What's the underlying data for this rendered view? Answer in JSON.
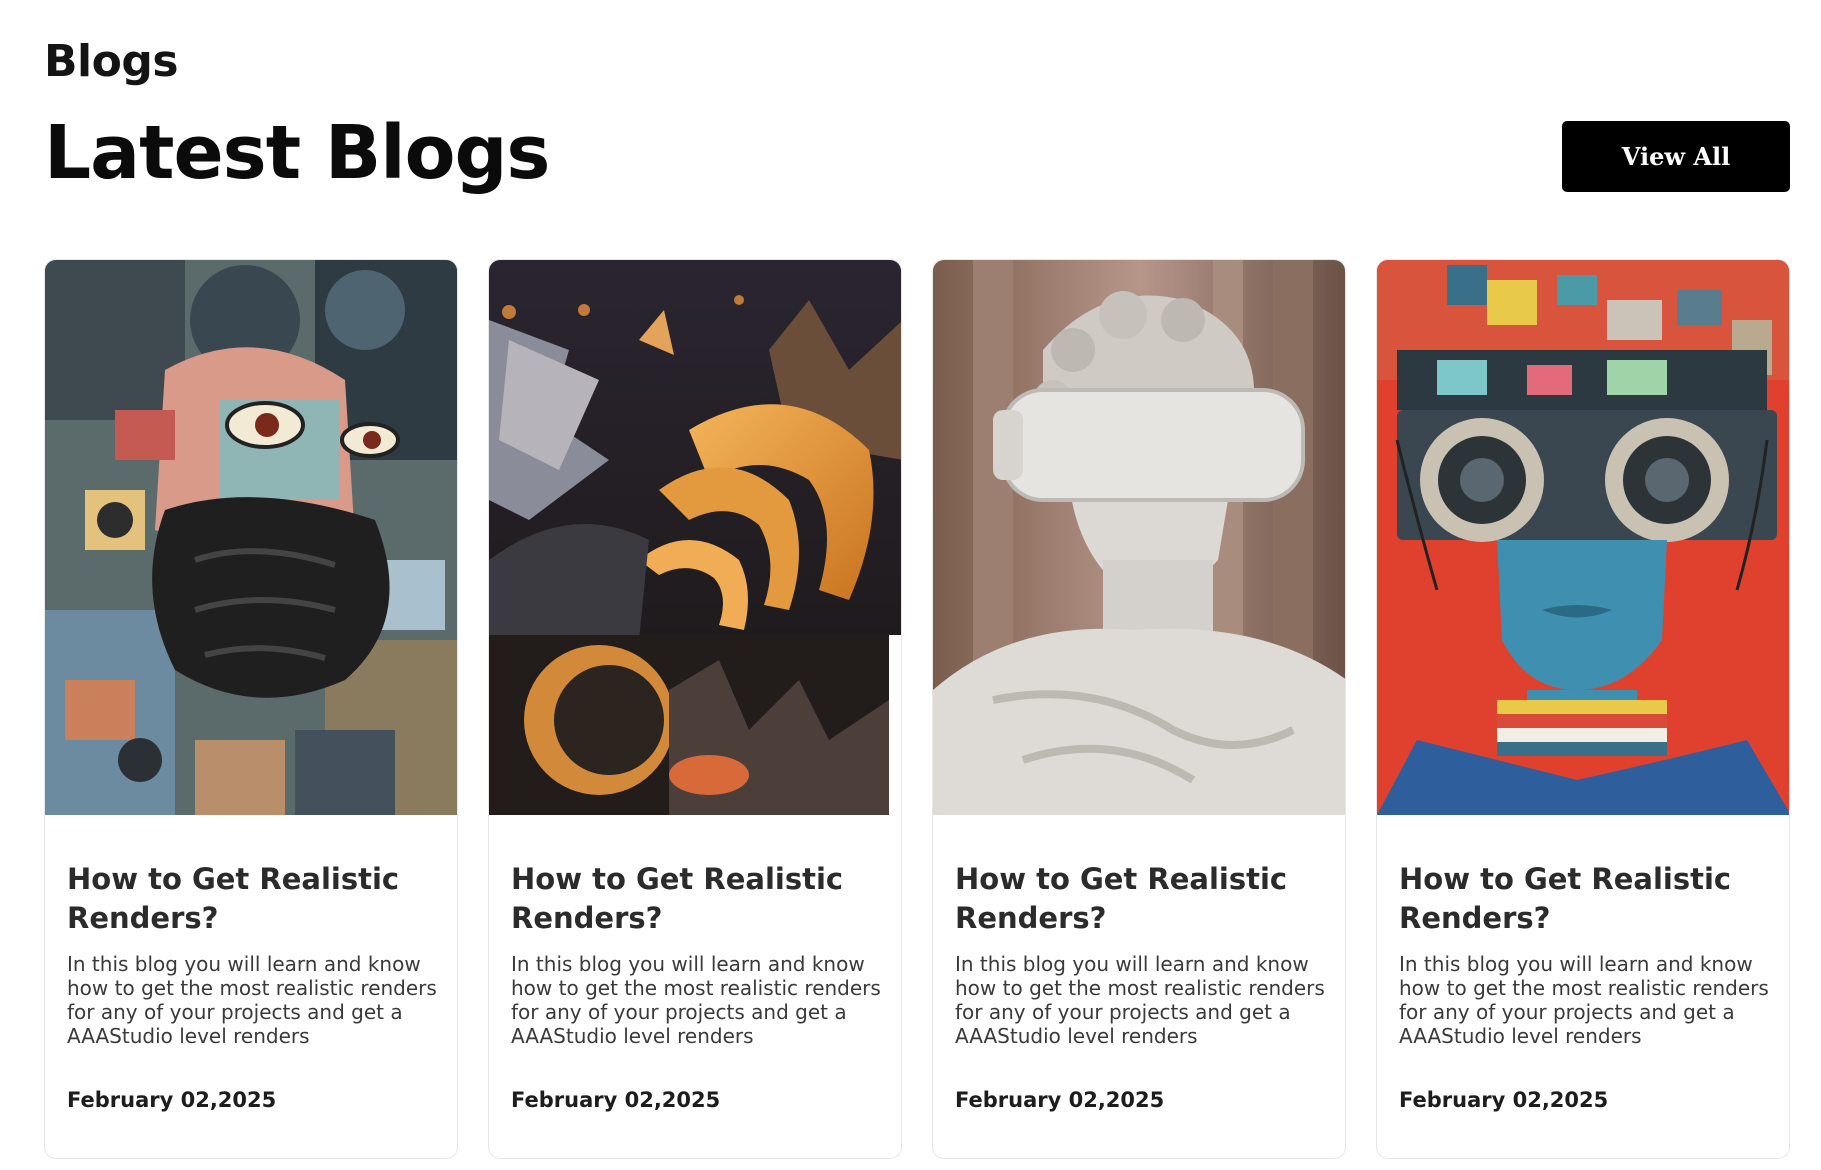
{
  "section": {
    "eyebrow": "Blogs",
    "title": "Latest Blogs",
    "view_all_label": "View All"
  },
  "cards": [
    {
      "image_name": "cubist-bearded-face-collage",
      "title": "How to Get Realistic Renders?",
      "description": "In this blog you will learn and know how to get the most realistic renders for any of your projects and get a AAAStudio level renders",
      "date": "February 02,2025"
    },
    {
      "image_name": "abstract-orange-3d-shapes",
      "title": "How to Get Realistic Renders?",
      "description": "In this blog you will learn and know how to get the most realistic renders for any of your projects and get a AAAStudio level renders",
      "date": "February 02,2025"
    },
    {
      "image_name": "marble-statue-vr-headset",
      "title": "How to Get Realistic Renders?",
      "description": "In this blog you will learn and know how to get the most realistic renders for any of your projects and get a AAAStudio level renders",
      "date": "February 02,2025"
    },
    {
      "image_name": "retro-tech-headgear-portrait",
      "title": "How to Get Realistic Renders?",
      "description": "In this blog you will learn and know how to get the most realistic renders for any of your projects and get a AAAStudio level renders",
      "date": "February 02,2025"
    }
  ],
  "colors": {
    "button_bg": "#000000",
    "button_text": "#ffffff",
    "heading": "#0b0b0b",
    "card_border": "#e7e7e7"
  }
}
